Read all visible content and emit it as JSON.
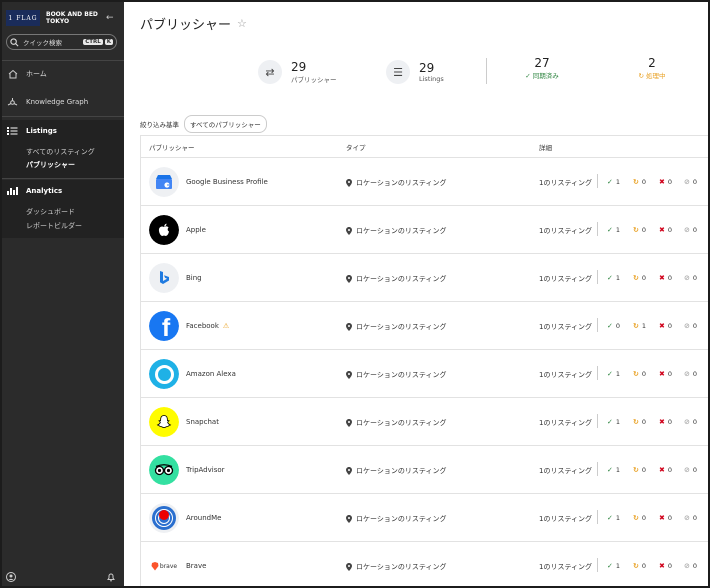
{
  "sidebar": {
    "logo_text": "1 FLAG",
    "brand_name": "BOOK AND BED TOKYO",
    "search_placeholder": "クイック検索",
    "search_kbd_1": "CTRL",
    "search_kbd_2": "K",
    "nav_home": "ホーム",
    "nav_knowledge_graph": "Knowledge Graph",
    "nav_listings": "Listings",
    "listings_items": [
      "すべてのリスティング",
      "パブリッシャー"
    ],
    "nav_analytics": "Analytics",
    "analytics_items": [
      "ダッシュボード",
      "レポートビルダー"
    ]
  },
  "header": {
    "title": "パブリッシャー"
  },
  "stats": {
    "publishers": {
      "value": "29",
      "label": "パブリッシャー"
    },
    "listings": {
      "value": "29",
      "label": "Listings"
    },
    "synced": {
      "value": "27",
      "label": "同期済み"
    },
    "processing": {
      "value": "2",
      "label": "処理中"
    }
  },
  "filter": {
    "label": "絞り込み基準",
    "chip": "すべてのパブリッシャー"
  },
  "table": {
    "headers": {
      "publisher": "パブリッシャー",
      "type": "タイプ",
      "detail": "詳細"
    },
    "rows": [
      {
        "name": "Google Business Profile",
        "type": "ロケーションのリスティング",
        "detail": "1のリスティング",
        "ok": "1",
        "proc": "0",
        "err": "0",
        "other": "0",
        "warn": false
      },
      {
        "name": "Apple",
        "type": "ロケーションのリスティング",
        "detail": "1のリスティング",
        "ok": "1",
        "proc": "0",
        "err": "0",
        "other": "0",
        "warn": false
      },
      {
        "name": "Bing",
        "type": "ロケーションのリスティング",
        "detail": "1のリスティング",
        "ok": "1",
        "proc": "0",
        "err": "0",
        "other": "0",
        "warn": false
      },
      {
        "name": "Facebook",
        "type": "ロケーションのリスティング",
        "detail": "1のリスティング",
        "ok": "0",
        "proc": "1",
        "err": "0",
        "other": "0",
        "warn": true
      },
      {
        "name": "Amazon Alexa",
        "type": "ロケーションのリスティング",
        "detail": "1のリスティング",
        "ok": "1",
        "proc": "0",
        "err": "0",
        "other": "0",
        "warn": false
      },
      {
        "name": "Snapchat",
        "type": "ロケーションのリスティング",
        "detail": "1のリスティング",
        "ok": "1",
        "proc": "0",
        "err": "0",
        "other": "0",
        "warn": false
      },
      {
        "name": "TripAdvisor",
        "type": "ロケーションのリスティング",
        "detail": "1のリスティング",
        "ok": "1",
        "proc": "0",
        "err": "0",
        "other": "0",
        "warn": false
      },
      {
        "name": "AroundMe",
        "type": "ロケーションのリスティング",
        "detail": "1のリスティング",
        "ok": "1",
        "proc": "0",
        "err": "0",
        "other": "0",
        "warn": false
      },
      {
        "name": "Brave",
        "type": "ロケーションのリスティング",
        "detail": "1のリスティング",
        "ok": "1",
        "proc": "0",
        "err": "0",
        "other": "0",
        "warn": false
      }
    ]
  }
}
